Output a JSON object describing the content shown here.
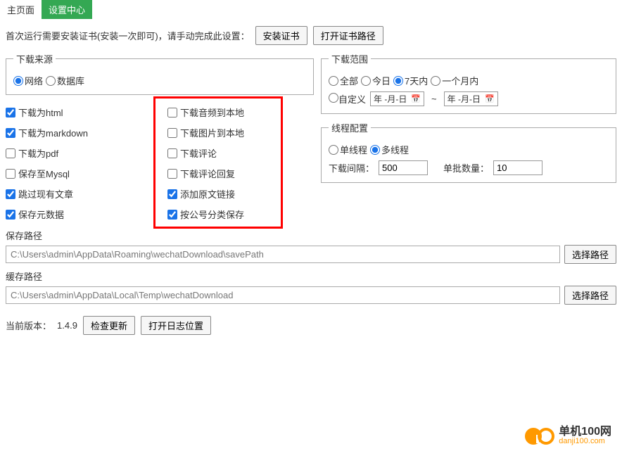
{
  "tabs": {
    "main": "主页面",
    "settings": "设置中心"
  },
  "cert": {
    "text": "首次运行需要安装证书(安装一次即可)，请手动完成此设置：",
    "install_btn": "安装证书",
    "open_path_btn": "打开证书路径"
  },
  "source": {
    "legend": "下载来源",
    "network": "网络",
    "database": "数据库"
  },
  "checks_left": {
    "html": "下载为html",
    "markdown": "下载为markdown",
    "pdf": "下载为pdf",
    "mysql": "保存至Mysql",
    "skip": "跳过现有文章",
    "meta": "保存元数据"
  },
  "checks_right": {
    "audio": "下载音频到本地",
    "image": "下载图片到本地",
    "comment": "下载评论",
    "reply": "下载评论回复",
    "origlink": "添加原文链接",
    "byaccount": "按公号分类保存"
  },
  "range": {
    "legend": "下载范围",
    "all": "全部",
    "today": "今日",
    "week": "7天内",
    "month": "一个月内",
    "custom": "自定义",
    "date_placeholder": "年 -月-日"
  },
  "thread": {
    "legend": "线程配置",
    "single": "单线程",
    "multi": "多线程",
    "interval_label": "下载间隔：",
    "interval_value": "500",
    "batch_label": "单批数量：",
    "batch_value": "10"
  },
  "savepath": {
    "label": "保存路径",
    "value": "C:\\Users\\admin\\AppData\\Roaming\\wechatDownload\\savePath",
    "btn": "选择路径"
  },
  "cachepath": {
    "label": "缓存路径",
    "value": "C:\\Users\\admin\\AppData\\Local\\Temp\\wechatDownload",
    "btn": "选择路径"
  },
  "version": {
    "label": "当前版本：",
    "value": "1.4.9",
    "check_btn": "检查更新",
    "log_btn": "打开日志位置"
  },
  "logo": {
    "cn": "单机100网",
    "url": "danji100.com"
  }
}
